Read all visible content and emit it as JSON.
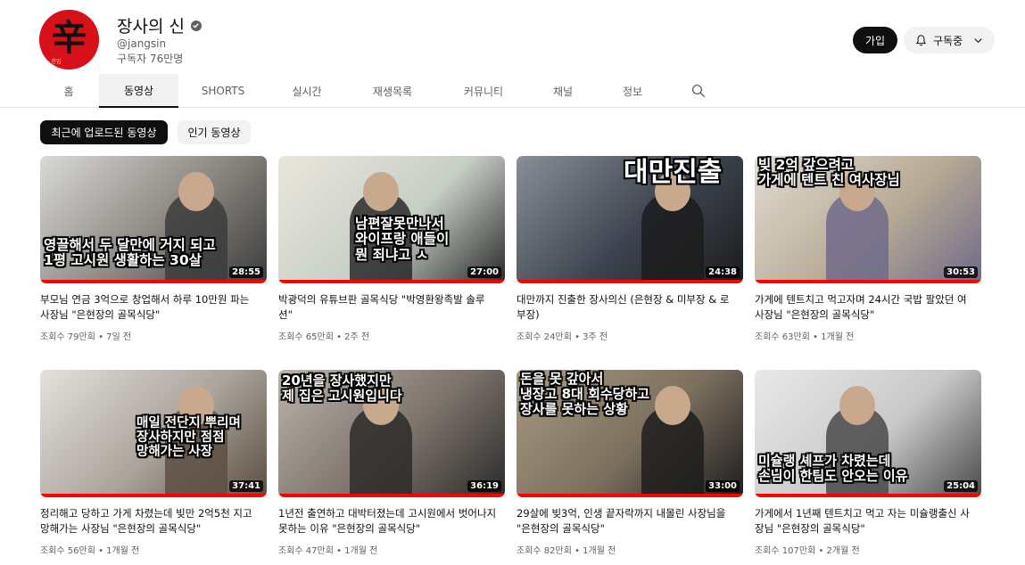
{
  "channel": {
    "name": "장사의 신",
    "handle": "@jangsin",
    "subscribers": "구독자 76만명",
    "avatar_text": "辛",
    "avatar_small": "한입",
    "join_label": "가입",
    "subscribe_label": "구독중"
  },
  "tabs": [
    "홈",
    "동영상",
    "SHORTS",
    "실시간",
    "재생목록",
    "커뮤니티",
    "채널",
    "정보"
  ],
  "chips": [
    "최근에 업로드된 동영상",
    "인기 동영상"
  ],
  "videos": [
    {
      "caption": "영끌해서 두 달만에 거지 되고\n1평 고시원 생활하는 30살",
      "duration": "28:55",
      "title": "부모님 연금 3억으로 창업해서 하루 10만원 파는 사장님 \"은현장의 골목식당\"",
      "views": "조회수 79만회",
      "age": "7일 전",
      "colors": [
        "#8a8680",
        "#d9d9d6",
        "#3c3c3c"
      ]
    },
    {
      "caption": "남편잘못만나서\n와이프랑 애들이\n뭔 죄냐고 ㅅ",
      "duration": "27:00",
      "title": "박광덕의 유튜브판 골목식당 \"박영환왕족발 솔루션\"",
      "views": "조회수 65만회",
      "age": "2주 전",
      "colors": [
        "#c7cfc6",
        "#eae6dc",
        "#2a2a2a"
      ]
    },
    {
      "caption": "대만진출",
      "duration": "24:38",
      "title": "대만까지 진출한 장사의신 (은현장 & 미부장 & 로부장)",
      "views": "조회수 24만회",
      "age": "3주 전",
      "colors": [
        "#3d4450",
        "#8a8f96",
        "#1c1c1c"
      ]
    },
    {
      "caption": "빚 2억 갚으려고\n가게에 텐트 친 여사장님",
      "duration": "30:53",
      "title": "가게에 텐트치고 먹고자며 24시간 국밥 팔았던 여사장님 \"은현장의 골목식당\"",
      "views": "조회수 63만회",
      "age": "1개월 전",
      "colors": [
        "#b7aa95",
        "#e2dcd2",
        "#6f6a8a"
      ]
    },
    {
      "caption": "매일 전단지 뿌리며\n장사하지만 점점\n망해가는 사장",
      "duration": "37:41",
      "title": "정리해고 당하고 가게 차렸는데 빚만 2억5천 지고 망해가는 사장님 \"은현장의 골목식당\"",
      "views": "조회수 56만회",
      "age": "1개월 전",
      "colors": [
        "#a9a49b",
        "#e4e1dc",
        "#5d4f43"
      ]
    },
    {
      "caption": "20년을 장사했지만\n제 집은 고시원입니다",
      "duration": "36:19",
      "title": "1년전 출연하고 대박터졌는데 고시원에서 벗어나지 못하는 이유 \"은현장의 골목식당\"",
      "views": "조회수 47만회",
      "age": "1개월 전",
      "colors": [
        "#7c736a",
        "#b9b3ab",
        "#2b2b2b"
      ]
    },
    {
      "caption": "돈을 못 갚아서\n냉장고 8대 회수당하고\n장사를 못하는 상황",
      "duration": "33:00",
      "title": "29살에 빚3억, 인생 끝자락까지 내몰린 사장님을 \"은현장의 골목식당\"",
      "views": "조회수 82만회",
      "age": "1개월 전",
      "colors": [
        "#7b6f5e",
        "#a89a83",
        "#1d1d1d"
      ]
    },
    {
      "caption": "미슐랭 셰프가 차렸는데\n손님이 한팀도 안오는 이유",
      "duration": "25:04",
      "title": "가게에서 1년째 텐트치고 먹고 자는 미슐랭출신 사장님 \"은현장의 골목식당\"",
      "views": "조회수 107만회",
      "age": "2개월 전",
      "colors": [
        "#c9c9c9",
        "#e9e9e9",
        "#4a4a4a"
      ]
    }
  ]
}
